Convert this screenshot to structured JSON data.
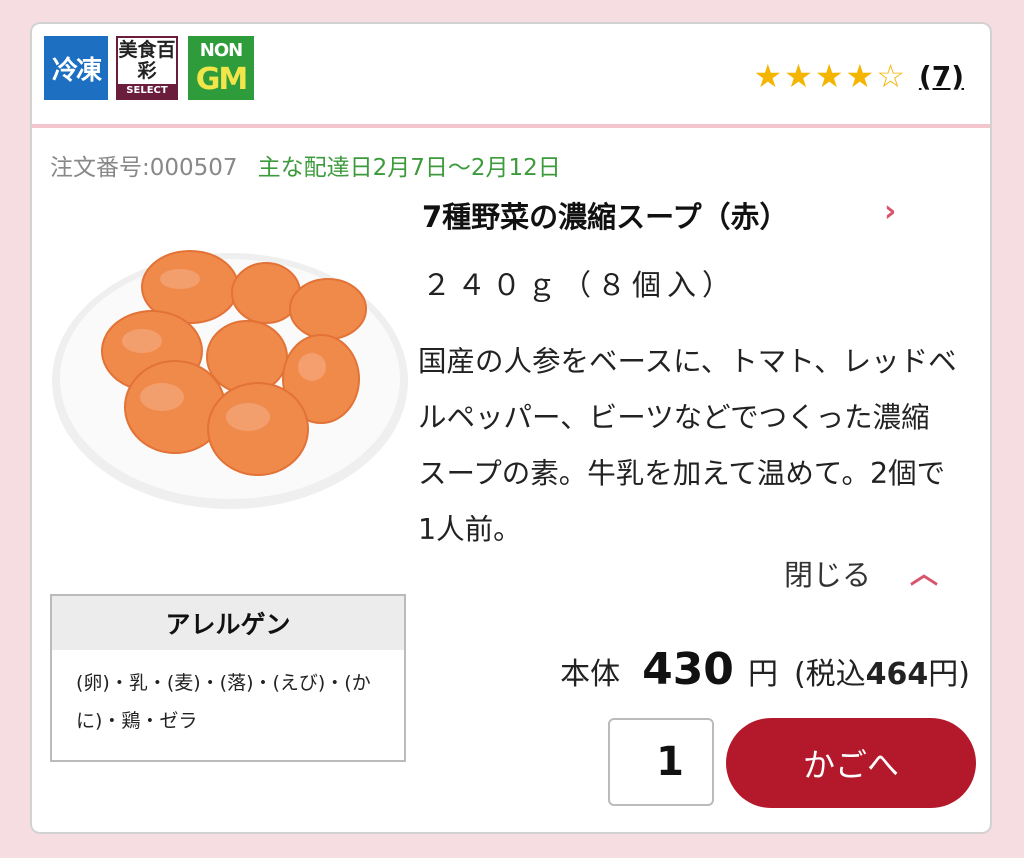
{
  "badges": {
    "frozen": "冷凍",
    "bisyoku": "美食百彩",
    "bisyoku_select": "SELECT",
    "nongm_top": "NON",
    "nongm_bottom": "GM"
  },
  "rating": {
    "stars_filled": 4,
    "stars_total": 5,
    "review_count": "(7)"
  },
  "order": {
    "order_number": "注文番号:000507",
    "delivery": "主な配達日2月7日～2月12日"
  },
  "product": {
    "title": "7種野菜の濃縮スープ（赤）",
    "quantity": "２４０ｇ（８個入）",
    "description": "国産の人参をベースに、トマト、レッドベルペッパー、ビーツなどでつくった濃縮スープの素。牛乳を加えて温めて。2個で1人前。",
    "close_label": "閉じる"
  },
  "allergen": {
    "heading": "アレルゲン",
    "list": "(卵)・乳・(麦)・(落)・(えび)・(かに)・鶏・ゼラ"
  },
  "price": {
    "label": "本体",
    "value": "430",
    "unit": "円",
    "tax_prefix": "(税込",
    "tax_value": "464",
    "tax_suffix": "円)"
  },
  "cart": {
    "quantity": "1",
    "button_label": "かごへ"
  },
  "colors": {
    "accent": "#b3192a",
    "delivery_green": "#3d9b3d",
    "star": "#f3b500",
    "background": "#f6dde2"
  }
}
